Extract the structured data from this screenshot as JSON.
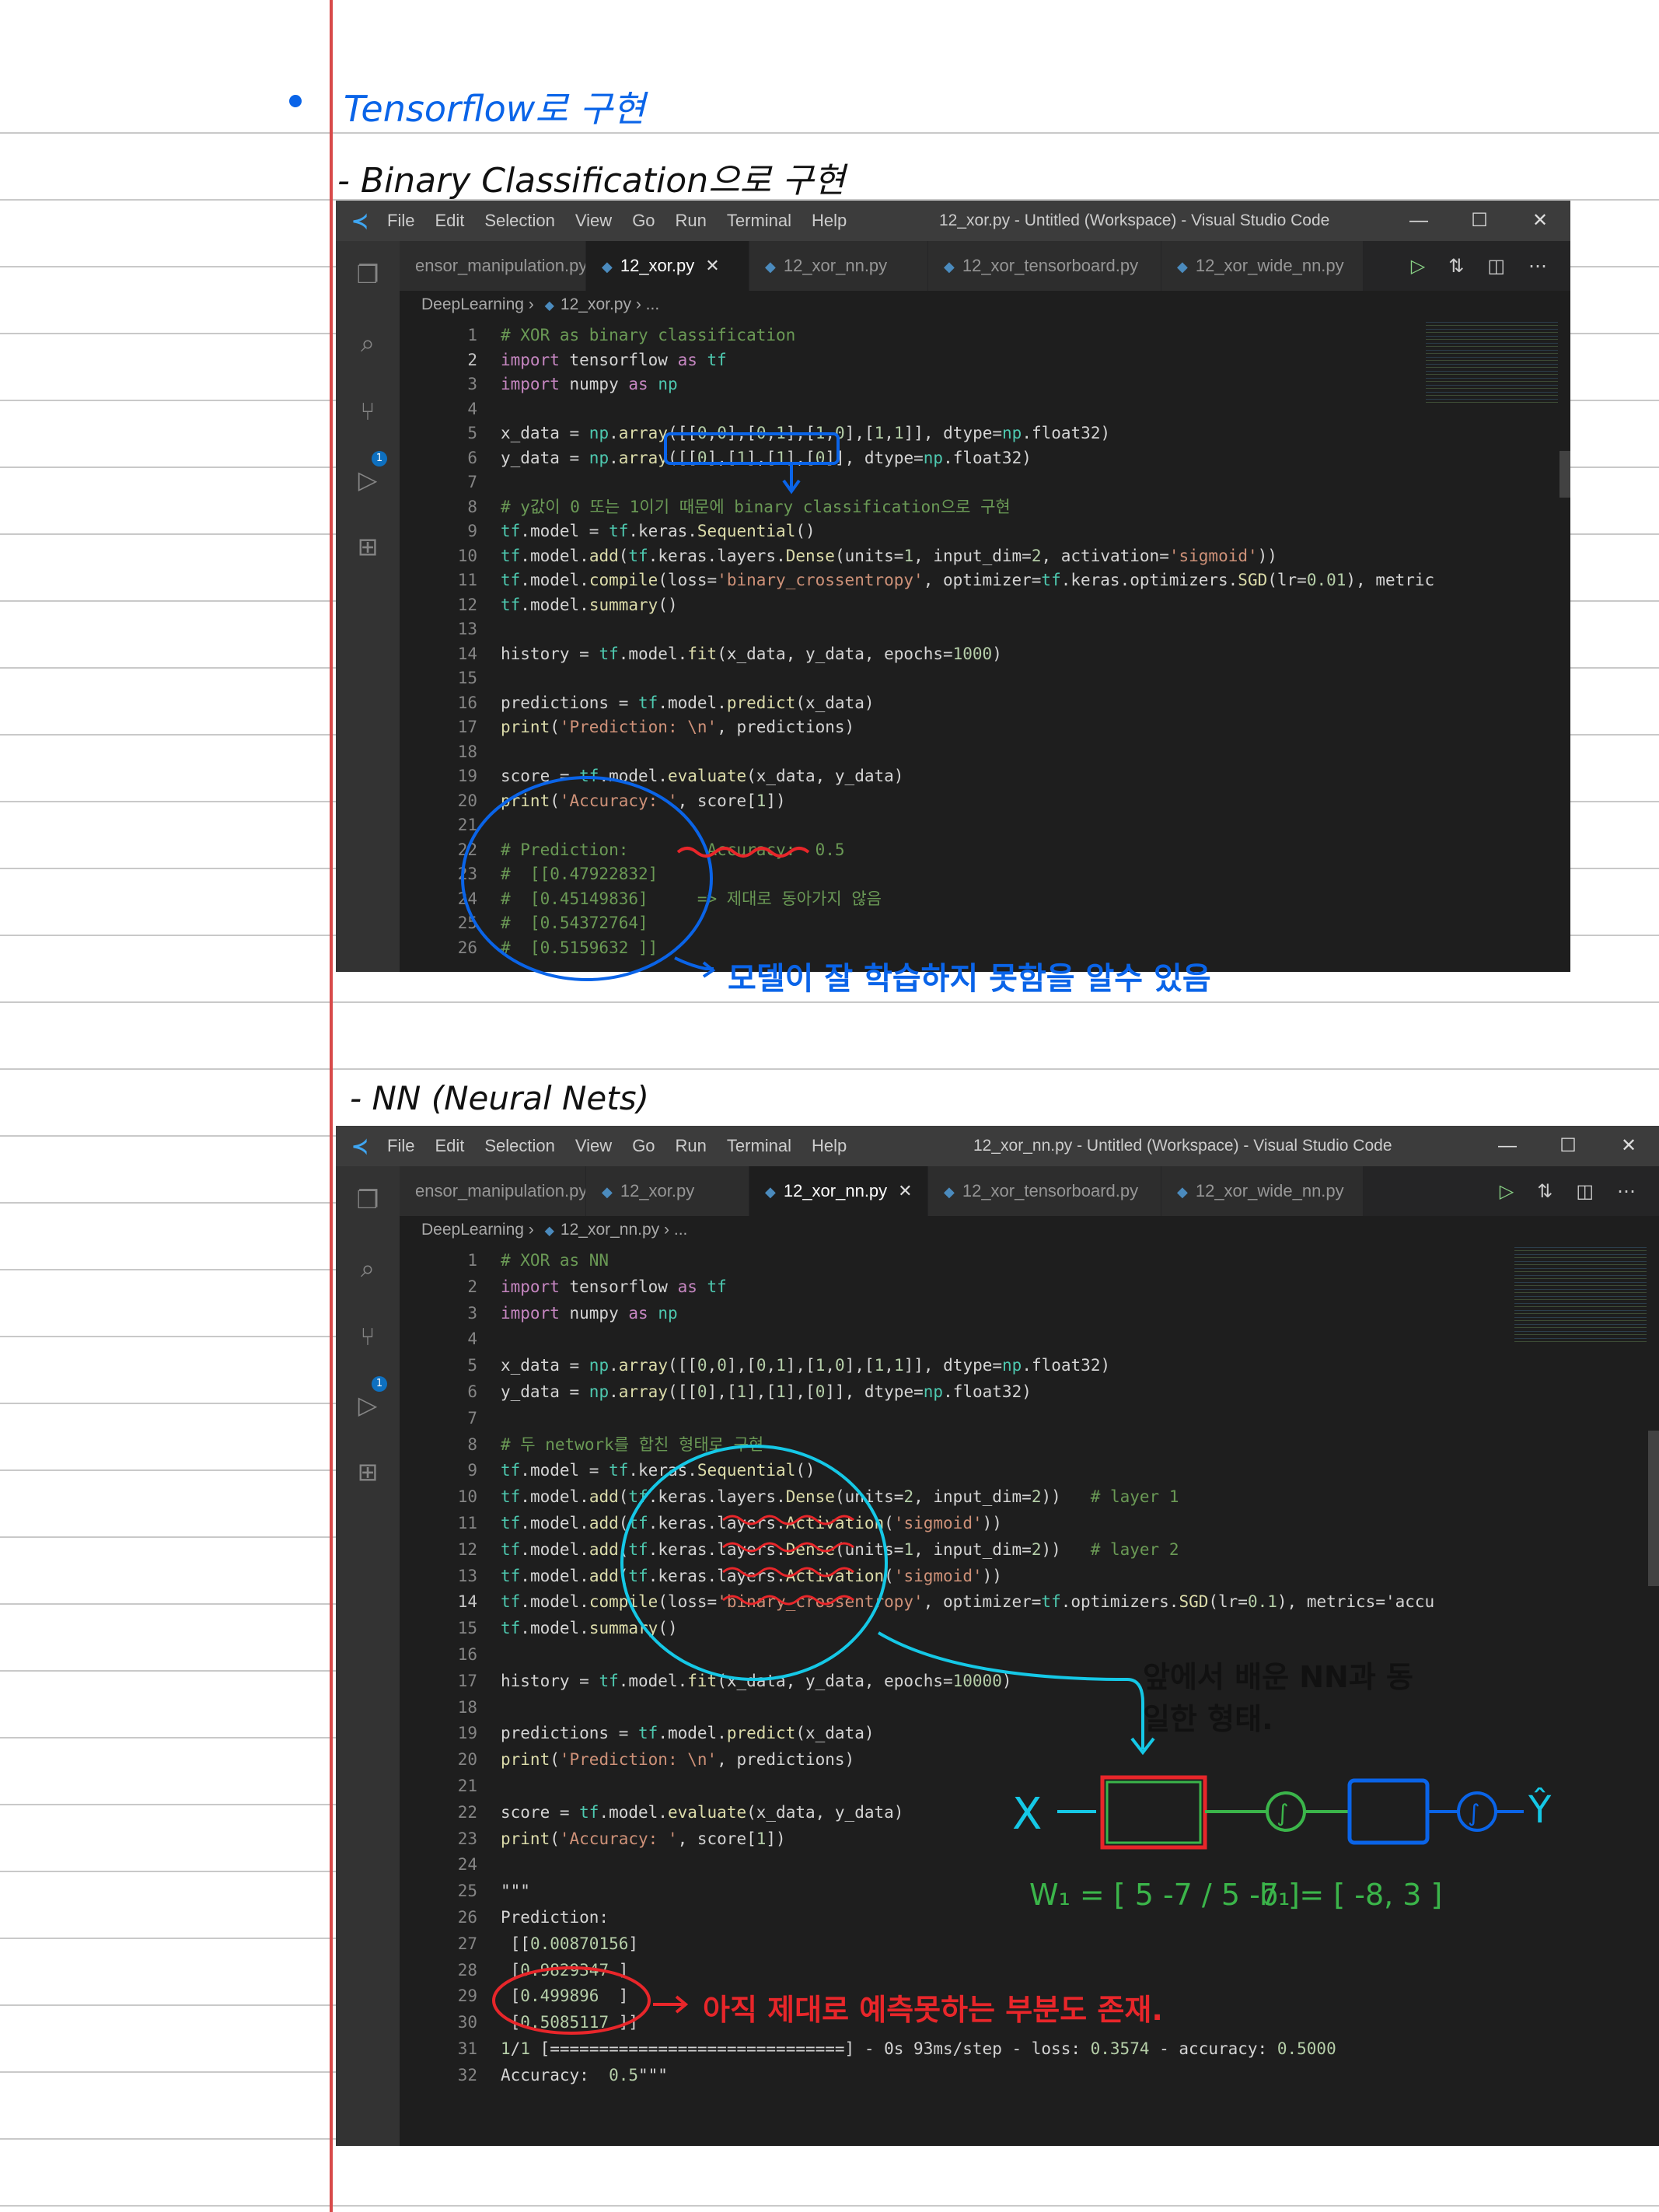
{
  "notes": {
    "bullet_title": "Tensorflow로 구현",
    "section1_heading": "- Binary Classification으로 구현",
    "section2_heading": "- NN (Neural Nets)",
    "note_model_not_learning": "모델이 잘 학습하지 못함을 알수 있음",
    "note_same_as_nn": "앞에서 배운 NN과 동일한 형태.",
    "note_partial_prediction": "아직 제대로 예측못하는 부분도 존재.",
    "diagram": {
      "x": "X",
      "y": "Ŷ",
      "sigmoid": "∫",
      "w1": "W₁ = [ 5  -7 / 5  -7 ]",
      "b1": "b₁ = [ -8, 3 ]"
    }
  },
  "window1": {
    "menu": [
      "File",
      "Edit",
      "Selection",
      "View",
      "Go",
      "Run",
      "Terminal",
      "Help"
    ],
    "title": "12_xor.py - Untitled (Workspace) - Visual Studio Code",
    "tabs": [
      "ensor_manipulation.py",
      "12_xor.py",
      "12_xor_nn.py",
      "12_xor_tensorboard.py",
      "12_xor_wide_nn.py"
    ],
    "active_tab": 1,
    "breadcrumb": {
      "folder": "DeepLearning",
      "file": "12_xor.py",
      "more": "..."
    },
    "current_line": 2,
    "lines": [
      "# XOR as binary classification",
      "import tensorflow as tf",
      "import numpy as np",
      "",
      "x_data = np.array([[0,0],[0,1],[1,0],[1,1]], dtype=np.float32)",
      "y_data = np.array([[0],[1],[1],[0]], dtype=np.float32)",
      "",
      "# y값이 0 또는 1이기 때문에 binary classification으로 구현",
      "tf.model = tf.keras.Sequential()",
      "tf.model.add(tf.keras.layers.Dense(units=1, input_dim=2, activation='sigmoid'))",
      "tf.model.compile(loss='binary_crossentropy', optimizer=tf.keras.optimizers.SGD(lr=0.01), metric",
      "tf.model.summary()",
      "",
      "history = tf.model.fit(x_data, y_data, epochs=1000)",
      "",
      "predictions = tf.model.predict(x_data)",
      "print('Prediction: \\n', predictions)",
      "",
      "score = tf.model.evaluate(x_data, y_data)",
      "print('Accuracy: ', score[1])",
      "",
      "# Prediction:        Accuracy:  0.5",
      "#  [[0.47922832]",
      "#  [0.45149836]     => 제대로 동아가지 않음",
      "#  [0.54372764]",
      "#  [0.5159632 ]]"
    ]
  },
  "window2": {
    "menu": [
      "File",
      "Edit",
      "Selection",
      "View",
      "Go",
      "Run",
      "Terminal",
      "Help"
    ],
    "title": "12_xor_nn.py - Untitled (Workspace) - Visual Studio Code",
    "tabs": [
      "ensor_manipulation.py",
      "12_xor.py",
      "12_xor_nn.py",
      "12_xor_tensorboard.py",
      "12_xor_wide_nn.py"
    ],
    "active_tab": 2,
    "breadcrumb": {
      "folder": "DeepLearning",
      "file": "12_xor_nn.py",
      "more": "..."
    },
    "current_line": 14,
    "lines": [
      "# XOR as NN",
      "import tensorflow as tf",
      "import numpy as np",
      "",
      "x_data = np.array([[0,0],[0,1],[1,0],[1,1]], dtype=np.float32)",
      "y_data = np.array([[0],[1],[1],[0]], dtype=np.float32)",
      "",
      "# 두 network를 합친 형태로 구현",
      "tf.model = tf.keras.Sequential()",
      "tf.model.add(tf.keras.layers.Dense(units=2, input_dim=2))   # layer 1",
      "tf.model.add(tf.keras.layers.Activation('sigmoid'))",
      "tf.model.add(tf.keras.layers.Dense(units=1, input_dim=2))   # layer 2",
      "tf.model.add(tf.keras.layers.Activation('sigmoid'))",
      "tf.model.compile(loss='binary_crossentropy', optimizer=tf.optimizers.SGD(lr=0.1), metrics='accu",
      "tf.model.summary()",
      "",
      "history = tf.model.fit(x_data, y_data, epochs=10000)",
      "",
      "predictions = tf.model.predict(x_data)",
      "print('Prediction: \\n', predictions)",
      "",
      "score = tf.model.evaluate(x_data, y_data)",
      "print('Accuracy: ', score[1])",
      "",
      "\"\"\"",
      "Prediction:",
      " [[0.00870156]",
      " [0.9829347 ]",
      " [0.499896  ]",
      " [0.5085117 ]]",
      "1/1 [==============================] - 0s 93ms/step - loss: 0.3574 - accuracy: 0.5000",
      "Accuracy:  0.5\"\"\""
    ]
  },
  "colors": {
    "ink_blue": "#0a64e8",
    "ink_cyan": "#15c8e6",
    "ink_red": "#e8262a",
    "ink_green": "#3bb54a",
    "margin_red": "#d84a4a"
  }
}
